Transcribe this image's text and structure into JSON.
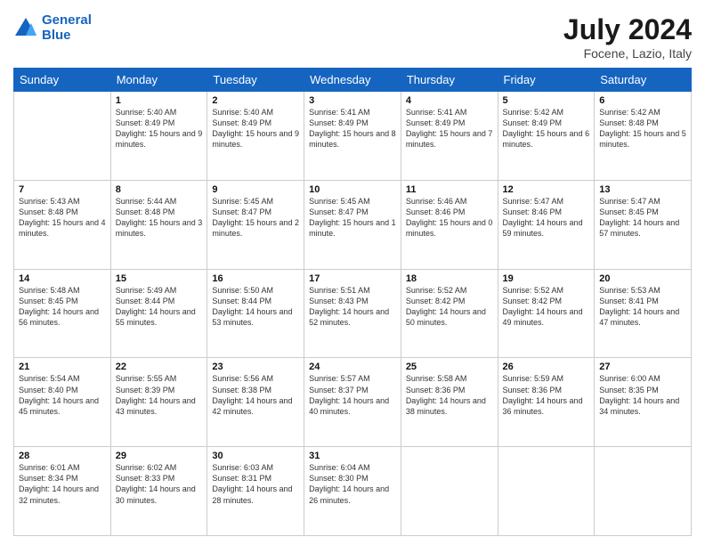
{
  "logo": {
    "line1": "General",
    "line2": "Blue"
  },
  "title": "July 2024",
  "location": "Focene, Lazio, Italy",
  "days_of_week": [
    "Sunday",
    "Monday",
    "Tuesday",
    "Wednesday",
    "Thursday",
    "Friday",
    "Saturday"
  ],
  "weeks": [
    [
      {
        "day": "",
        "sunrise": "",
        "sunset": "",
        "daylight": ""
      },
      {
        "day": "1",
        "sunrise": "Sunrise: 5:40 AM",
        "sunset": "Sunset: 8:49 PM",
        "daylight": "Daylight: 15 hours and 9 minutes."
      },
      {
        "day": "2",
        "sunrise": "Sunrise: 5:40 AM",
        "sunset": "Sunset: 8:49 PM",
        "daylight": "Daylight: 15 hours and 9 minutes."
      },
      {
        "day": "3",
        "sunrise": "Sunrise: 5:41 AM",
        "sunset": "Sunset: 8:49 PM",
        "daylight": "Daylight: 15 hours and 8 minutes."
      },
      {
        "day": "4",
        "sunrise": "Sunrise: 5:41 AM",
        "sunset": "Sunset: 8:49 PM",
        "daylight": "Daylight: 15 hours and 7 minutes."
      },
      {
        "day": "5",
        "sunrise": "Sunrise: 5:42 AM",
        "sunset": "Sunset: 8:49 PM",
        "daylight": "Daylight: 15 hours and 6 minutes."
      },
      {
        "day": "6",
        "sunrise": "Sunrise: 5:42 AM",
        "sunset": "Sunset: 8:48 PM",
        "daylight": "Daylight: 15 hours and 5 minutes."
      }
    ],
    [
      {
        "day": "7",
        "sunrise": "Sunrise: 5:43 AM",
        "sunset": "Sunset: 8:48 PM",
        "daylight": "Daylight: 15 hours and 4 minutes."
      },
      {
        "day": "8",
        "sunrise": "Sunrise: 5:44 AM",
        "sunset": "Sunset: 8:48 PM",
        "daylight": "Daylight: 15 hours and 3 minutes."
      },
      {
        "day": "9",
        "sunrise": "Sunrise: 5:45 AM",
        "sunset": "Sunset: 8:47 PM",
        "daylight": "Daylight: 15 hours and 2 minutes."
      },
      {
        "day": "10",
        "sunrise": "Sunrise: 5:45 AM",
        "sunset": "Sunset: 8:47 PM",
        "daylight": "Daylight: 15 hours and 1 minute."
      },
      {
        "day": "11",
        "sunrise": "Sunrise: 5:46 AM",
        "sunset": "Sunset: 8:46 PM",
        "daylight": "Daylight: 15 hours and 0 minutes."
      },
      {
        "day": "12",
        "sunrise": "Sunrise: 5:47 AM",
        "sunset": "Sunset: 8:46 PM",
        "daylight": "Daylight: 14 hours and 59 minutes."
      },
      {
        "day": "13",
        "sunrise": "Sunrise: 5:47 AM",
        "sunset": "Sunset: 8:45 PM",
        "daylight": "Daylight: 14 hours and 57 minutes."
      }
    ],
    [
      {
        "day": "14",
        "sunrise": "Sunrise: 5:48 AM",
        "sunset": "Sunset: 8:45 PM",
        "daylight": "Daylight: 14 hours and 56 minutes."
      },
      {
        "day": "15",
        "sunrise": "Sunrise: 5:49 AM",
        "sunset": "Sunset: 8:44 PM",
        "daylight": "Daylight: 14 hours and 55 minutes."
      },
      {
        "day": "16",
        "sunrise": "Sunrise: 5:50 AM",
        "sunset": "Sunset: 8:44 PM",
        "daylight": "Daylight: 14 hours and 53 minutes."
      },
      {
        "day": "17",
        "sunrise": "Sunrise: 5:51 AM",
        "sunset": "Sunset: 8:43 PM",
        "daylight": "Daylight: 14 hours and 52 minutes."
      },
      {
        "day": "18",
        "sunrise": "Sunrise: 5:52 AM",
        "sunset": "Sunset: 8:42 PM",
        "daylight": "Daylight: 14 hours and 50 minutes."
      },
      {
        "day": "19",
        "sunrise": "Sunrise: 5:52 AM",
        "sunset": "Sunset: 8:42 PM",
        "daylight": "Daylight: 14 hours and 49 minutes."
      },
      {
        "day": "20",
        "sunrise": "Sunrise: 5:53 AM",
        "sunset": "Sunset: 8:41 PM",
        "daylight": "Daylight: 14 hours and 47 minutes."
      }
    ],
    [
      {
        "day": "21",
        "sunrise": "Sunrise: 5:54 AM",
        "sunset": "Sunset: 8:40 PM",
        "daylight": "Daylight: 14 hours and 45 minutes."
      },
      {
        "day": "22",
        "sunrise": "Sunrise: 5:55 AM",
        "sunset": "Sunset: 8:39 PM",
        "daylight": "Daylight: 14 hours and 43 minutes."
      },
      {
        "day": "23",
        "sunrise": "Sunrise: 5:56 AM",
        "sunset": "Sunset: 8:38 PM",
        "daylight": "Daylight: 14 hours and 42 minutes."
      },
      {
        "day": "24",
        "sunrise": "Sunrise: 5:57 AM",
        "sunset": "Sunset: 8:37 PM",
        "daylight": "Daylight: 14 hours and 40 minutes."
      },
      {
        "day": "25",
        "sunrise": "Sunrise: 5:58 AM",
        "sunset": "Sunset: 8:36 PM",
        "daylight": "Daylight: 14 hours and 38 minutes."
      },
      {
        "day": "26",
        "sunrise": "Sunrise: 5:59 AM",
        "sunset": "Sunset: 8:36 PM",
        "daylight": "Daylight: 14 hours and 36 minutes."
      },
      {
        "day": "27",
        "sunrise": "Sunrise: 6:00 AM",
        "sunset": "Sunset: 8:35 PM",
        "daylight": "Daylight: 14 hours and 34 minutes."
      }
    ],
    [
      {
        "day": "28",
        "sunrise": "Sunrise: 6:01 AM",
        "sunset": "Sunset: 8:34 PM",
        "daylight": "Daylight: 14 hours and 32 minutes."
      },
      {
        "day": "29",
        "sunrise": "Sunrise: 6:02 AM",
        "sunset": "Sunset: 8:33 PM",
        "daylight": "Daylight: 14 hours and 30 minutes."
      },
      {
        "day": "30",
        "sunrise": "Sunrise: 6:03 AM",
        "sunset": "Sunset: 8:31 PM",
        "daylight": "Daylight: 14 hours and 28 minutes."
      },
      {
        "day": "31",
        "sunrise": "Sunrise: 6:04 AM",
        "sunset": "Sunset: 8:30 PM",
        "daylight": "Daylight: 14 hours and 26 minutes."
      },
      {
        "day": "",
        "sunrise": "",
        "sunset": "",
        "daylight": ""
      },
      {
        "day": "",
        "sunrise": "",
        "sunset": "",
        "daylight": ""
      },
      {
        "day": "",
        "sunrise": "",
        "sunset": "",
        "daylight": ""
      }
    ]
  ]
}
